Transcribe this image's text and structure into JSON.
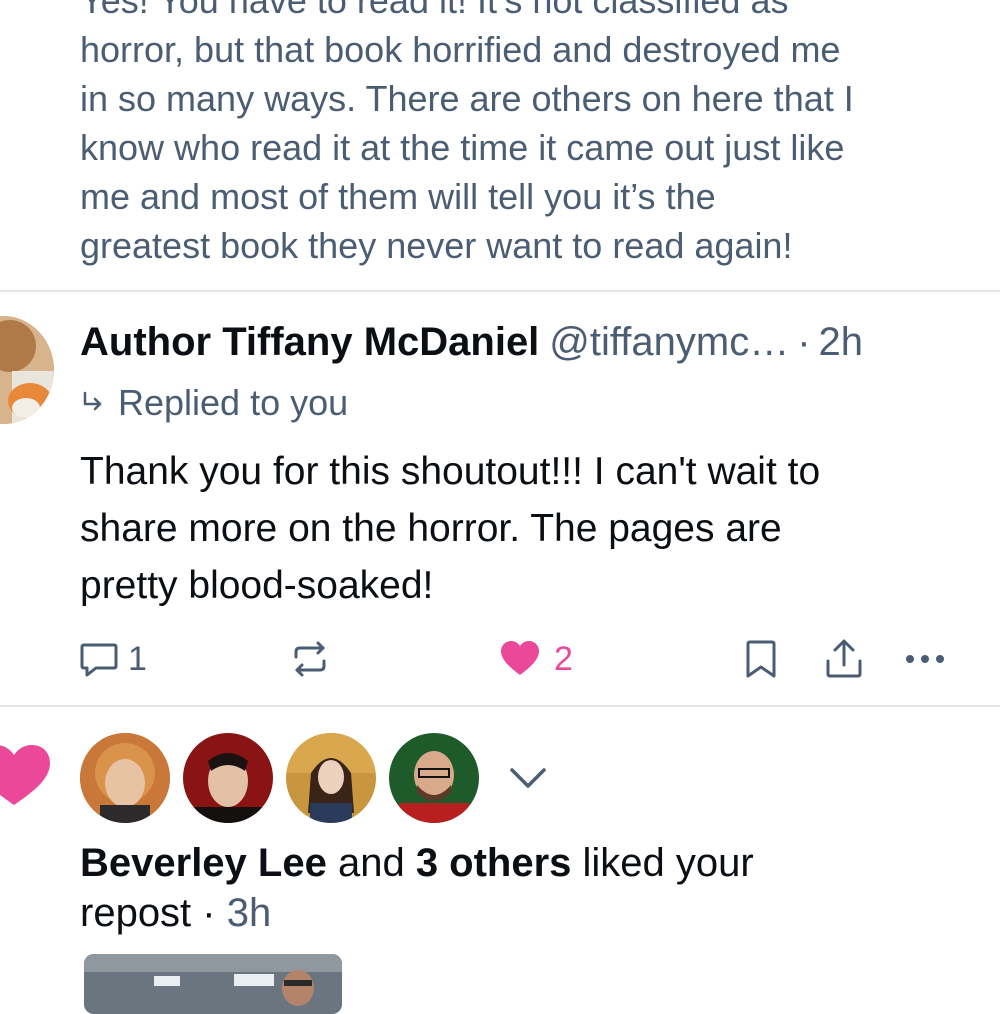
{
  "previous_post": {
    "lines": [
      "Yes! You have to read it! It’s not classified as",
      "horror, but that book horrified and destroyed me",
      "in so many ways. There are others on here that I",
      "know who read it at the time it came out just like",
      "me and most of them will tell you it’s the",
      "greatest book they never want to read again!"
    ]
  },
  "reply": {
    "author": "Author Tiffany McDaniel",
    "handle": "@tiffanymc…",
    "separator": "·",
    "time": "2h",
    "replied_to": "Replied to you",
    "body_lines": [
      "Thank you for this shoutout!!! I can't wait to",
      "share more on the horror. The pages are",
      "pretty blood-soaked!"
    ],
    "reply_count": "1",
    "like_count": "2",
    "icons": [
      "reply-icon",
      "repost-icon",
      "heart-icon",
      "bookmark-icon",
      "share-icon",
      "more-icon"
    ],
    "like_color": "#ec4899",
    "icon_color": "#4a5d72"
  },
  "like_notification": {
    "name": "Beverley Lee",
    "and_text": " and ",
    "others": "3 others",
    "liked_text": " liked your",
    "line2_prefix": "repost · ",
    "time": "3h",
    "icons": [
      "heart-icon",
      "chevron-down-icon"
    ]
  }
}
